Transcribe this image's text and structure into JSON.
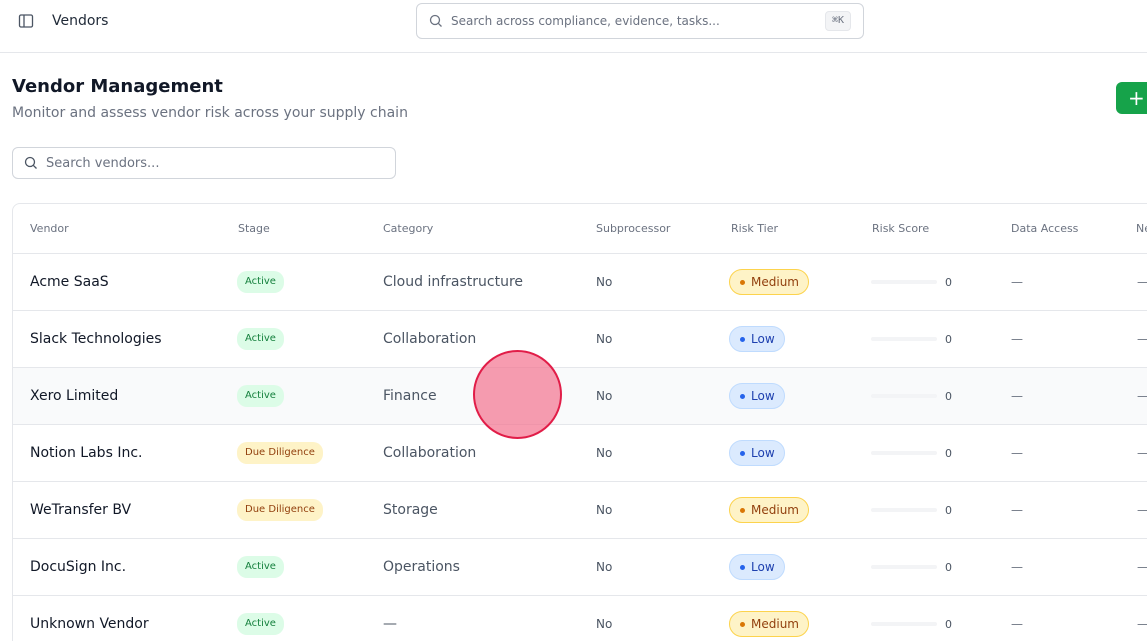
{
  "topbar": {
    "title": "Vendors",
    "search_placeholder": "Search across compliance, evidence, tasks...",
    "shortcut": "⌘K"
  },
  "page": {
    "title": "Vendor Management",
    "subtitle": "Monitor and assess vendor risk across your supply chain",
    "add_label": "+"
  },
  "vendor_search": {
    "placeholder": "Search vendors..."
  },
  "table": {
    "columns": [
      "Vendor",
      "Stage",
      "Category",
      "Subprocessor",
      "Risk Tier",
      "Risk Score",
      "Data Access",
      "Ne"
    ],
    "rows": [
      {
        "vendor": "Acme SaaS",
        "stage": "Active",
        "category": "Cloud infrastructure",
        "subprocessor": "No",
        "risk_tier": "Medium",
        "risk_score": "0",
        "data_access": "—",
        "next": "—"
      },
      {
        "vendor": "Slack Technologies",
        "stage": "Active",
        "category": "Collaboration",
        "subprocessor": "No",
        "risk_tier": "Low",
        "risk_score": "0",
        "data_access": "—",
        "next": "—"
      },
      {
        "vendor": "Xero Limited",
        "stage": "Active",
        "category": "Finance",
        "subprocessor": "No",
        "risk_tier": "Low",
        "risk_score": "0",
        "data_access": "—",
        "next": "—"
      },
      {
        "vendor": "Notion Labs Inc.",
        "stage": "Due Diligence",
        "category": "Collaboration",
        "subprocessor": "No",
        "risk_tier": "Low",
        "risk_score": "0",
        "data_access": "—",
        "next": "—"
      },
      {
        "vendor": "WeTransfer BV",
        "stage": "Due Diligence",
        "category": "Storage",
        "subprocessor": "No",
        "risk_tier": "Medium",
        "risk_score": "0",
        "data_access": "—",
        "next": "—"
      },
      {
        "vendor": "DocuSign Inc.",
        "stage": "Active",
        "category": "Operations",
        "subprocessor": "No",
        "risk_tier": "Low",
        "risk_score": "0",
        "data_access": "—",
        "next": "—"
      },
      {
        "vendor": "Unknown Vendor",
        "stage": "Active",
        "category": "—",
        "subprocessor": "No",
        "risk_tier": "Medium",
        "risk_score": "0",
        "data_access": "—",
        "next": "—"
      }
    ]
  },
  "colors": {
    "primary": "#16a34a",
    "stage_active_bg": "#dcfce7",
    "stage_due_bg": "#fef3c7",
    "risk_medium_bg": "#fef3c7",
    "risk_low_bg": "#dbeafe"
  },
  "icons": {
    "sidebar_toggle": "sidebar-icon",
    "search": "search-icon"
  }
}
